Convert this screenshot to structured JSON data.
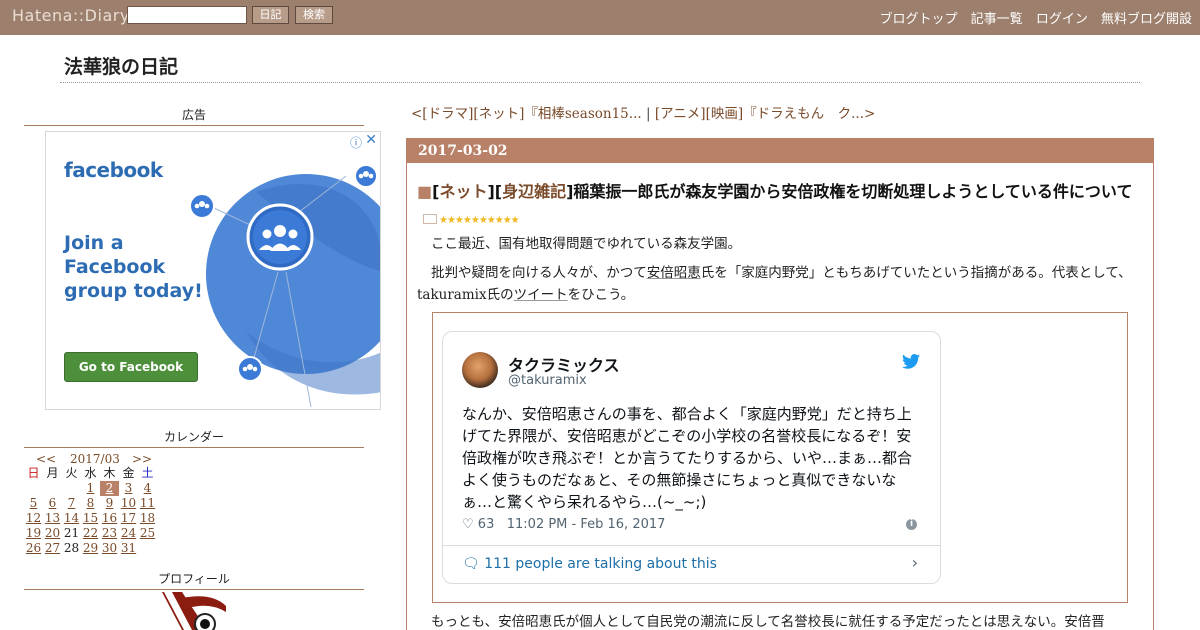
{
  "topbar": {
    "logo": "Hatena::Diary",
    "search_placeholder": "",
    "diary_button": "日記",
    "search_button": "検索",
    "nav": [
      "ブログトップ",
      "記事一覧",
      "ログイン",
      "無料ブログ開設"
    ]
  },
  "blog": {
    "title": "法華狼の日記"
  },
  "sidebar": {
    "ad_heading": "広告",
    "ad": {
      "brand": "facebook",
      "copy": "Join a Facebook group today!",
      "button": "Go to Facebook",
      "info_icon": "info-icon",
      "close_icon": "close-icon"
    },
    "calendar_heading": "カレンダー",
    "calendar": {
      "prev": "<<",
      "month": "2017/03",
      "next": ">>",
      "weekdays": [
        "日",
        "月",
        "火",
        "水",
        "木",
        "金",
        "土"
      ],
      "weeks": [
        [
          "",
          "",
          "",
          "1",
          "2",
          "3",
          "4"
        ],
        [
          "5",
          "6",
          "7",
          "8",
          "9",
          "10",
          "11"
        ],
        [
          "12",
          "13",
          "14",
          "15",
          "16",
          "17",
          "18"
        ],
        [
          "19",
          "20",
          "21",
          "22",
          "23",
          "24",
          "25"
        ],
        [
          "26",
          "27",
          "28",
          "29",
          "30",
          "31",
          ""
        ]
      ],
      "selected_day": "2",
      "unlinked_days": [
        "21",
        "28"
      ]
    },
    "profile_heading": "プロフィール"
  },
  "main": {
    "pager_prev": "<[ドラマ][ネット]『相棒season15...",
    "pager_sep": "|",
    "pager_next": "[アニメ][映画]『ドラえもん　ク...>",
    "entry": {
      "date": "2017-03-02",
      "title_square": "■",
      "cat1": "ネット",
      "cat2": "身辺雑記",
      "title": "稲葉振一郎氏が森友学園から安倍政権を切断処理しようとしている件について",
      "stars": "★★★★★★★★★★",
      "para1": "ここ最近、国有地取得問題でゆれている森友学園。",
      "para2_a": "批判や疑問を向ける人々が、かつて",
      "para2_link1": "安倍昭恵",
      "para2_b": "氏を「家庭内野党」ともちあげていたという指摘がある。代表として、takuramix氏の",
      "para2_link2": "ツイート",
      "para2_c": "をひこう。",
      "tweet": {
        "name": "タクラミックス",
        "handle": "@takuramix",
        "text": "なんか、安倍昭恵さんの事を、都合よく「家庭内野党」だと持ち上げてた界隈が、安倍昭恵がどこぞの小学校の名誉校長になるぞ！安倍政権が吹き飛ぶぞ！とか言うてたりするから、いや…まぁ…都合よく使うものだなぁと、その無節操さにちょっと真似できないなぁ…と驚くやら呆れるやら…(~_~;)",
        "likes": "63",
        "time": "11:02 PM - Feb 16, 2017",
        "talking": "111 people are talking about this"
      },
      "para3": "もっとも、安倍昭恵氏が個人として自民党の潮流に反して名誉校長に就任する予定だったとは思えない。安倍晋"
    }
  },
  "colors": {
    "accent": "#b98268",
    "topbar": "#9d7f6d",
    "link": "#7a4b2a",
    "facebook": "#2d6cb3"
  }
}
